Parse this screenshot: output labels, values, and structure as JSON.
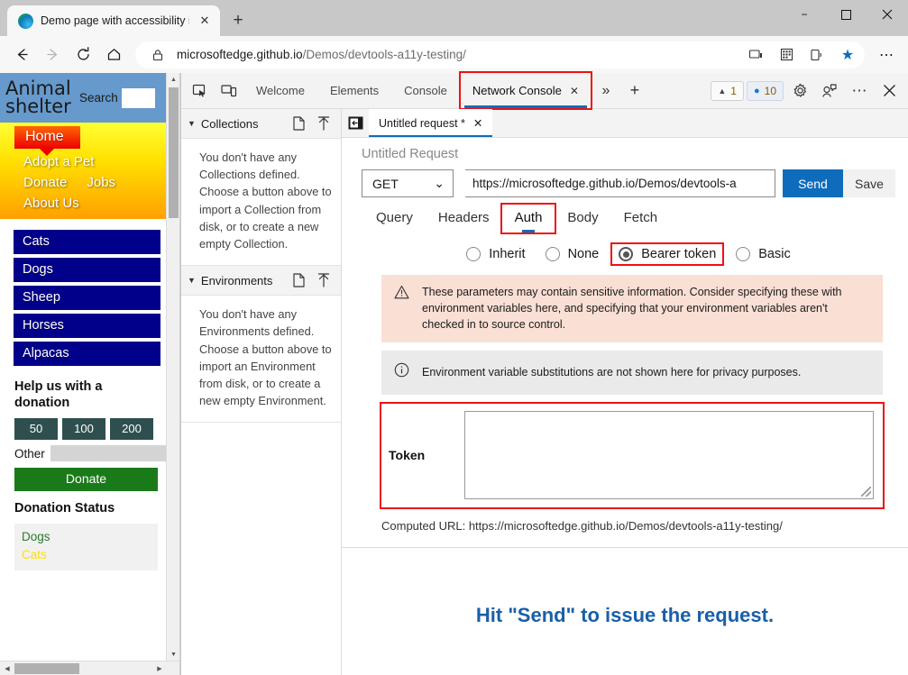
{
  "browser": {
    "tab_title": "Demo page with accessibility iss",
    "tab_close": "✕",
    "new_tab": "+",
    "nav": {
      "back": "←",
      "forward": "→",
      "reload": "⟳",
      "home": "⌂"
    },
    "url_scheme": "https://",
    "url_host": "microsoftedge.github.io",
    "url_path": "/Demos/devtools-a11y-testing/",
    "toolbar_icons": [
      "cast-icon",
      "collections-icon",
      "read-aloud-icon",
      "favorite-star-icon",
      "settings-more-icon"
    ],
    "more_label": "⋯",
    "window_controls": {
      "minimize": "−",
      "maximize": "▢",
      "close": "✕"
    }
  },
  "webpage": {
    "site_title": "Animal shelter",
    "search_label": "Search",
    "search_value": "",
    "nav": {
      "home": "Home",
      "adopt": "Adopt a Pet",
      "donate": "Donate",
      "jobs": "Jobs",
      "about": "About Us"
    },
    "animals": [
      "Cats",
      "Dogs",
      "Sheep",
      "Horses",
      "Alpacas"
    ],
    "donation_heading": "Help us with a donation",
    "amounts": [
      "50",
      "100",
      "200"
    ],
    "other_label": "Other",
    "other_value": "",
    "donate_button": "Donate",
    "status_heading": "Donation Status",
    "status_items": [
      {
        "label": "Dogs",
        "color": "#2a7a2a"
      },
      {
        "label": "Cats",
        "color": "#ffe000"
      }
    ]
  },
  "devtools": {
    "tabs": [
      {
        "label": "Welcome",
        "active": false
      },
      {
        "label": "Elements",
        "active": false
      },
      {
        "label": "Console",
        "active": false
      },
      {
        "label": "Network Console",
        "active": true,
        "closable": true,
        "annotated": true
      }
    ],
    "overflow": "»",
    "add_tab": "+",
    "warnings_count": "1",
    "messages_count": "10",
    "icons": [
      "inspect-element-icon",
      "device-emulation-icon",
      "settings-gear-icon",
      "feedback-icon",
      "more-tools-icon",
      "close-devtools-icon"
    ],
    "close_glyph": "✕",
    "more_glyph": "⋯"
  },
  "collections": {
    "title": "Collections",
    "empty_text": "You don't have any Collections defined. Choose a button above to import a Collection from disk, or to create a new empty Collection.",
    "new_icon": "new-file-icon",
    "import_icon": "import-upload-icon"
  },
  "environments": {
    "title": "Environments",
    "empty_text": "You don't have any Environments defined. Choose a button above to import an Environment from disk, or to create a new empty Environment.",
    "new_icon": "new-file-icon",
    "import_icon": "import-upload-icon"
  },
  "request": {
    "tab_label": "Untitled request *",
    "tab_close": "✕",
    "dock_icon": "dock-panel-icon",
    "name": "Untitled Request",
    "method": "GET",
    "method_caret": "⌄",
    "url": "https://microsoftedge.github.io/Demos/devtools-a",
    "send_label": "Send",
    "save_label": "Save",
    "sub_tabs": [
      {
        "label": "Query",
        "active": false
      },
      {
        "label": "Headers",
        "active": false
      },
      {
        "label": "Auth",
        "active": true,
        "annotated": true
      },
      {
        "label": "Body",
        "active": false
      },
      {
        "label": "Fetch",
        "active": false
      }
    ],
    "auth_options": [
      {
        "label": "Inherit",
        "selected": false
      },
      {
        "label": "None",
        "selected": false
      },
      {
        "label": "Bearer token",
        "selected": true,
        "annotated": true
      },
      {
        "label": "Basic",
        "selected": false
      }
    ],
    "warning_banner": "These parameters may contain sensitive information. Consider specifying these with environment variables here, and specifying that your environment variables aren't checked in to source control.",
    "info_banner": "Environment variable substitutions are not shown here for privacy purposes.",
    "token_label": "Token",
    "token_value": "",
    "computed_url": "Computed URL: https://microsoftedge.github.io/Demos/devtools-a11y-testing/",
    "response_placeholder": "Hit \"Send\" to issue the request."
  },
  "colors": {
    "accent_blue": "#0f6cbd",
    "annotation_red": "#ee1111",
    "warn_bg": "#fadfd5",
    "info_bg": "#eaeaea",
    "response_text": "#1a5fa8"
  }
}
